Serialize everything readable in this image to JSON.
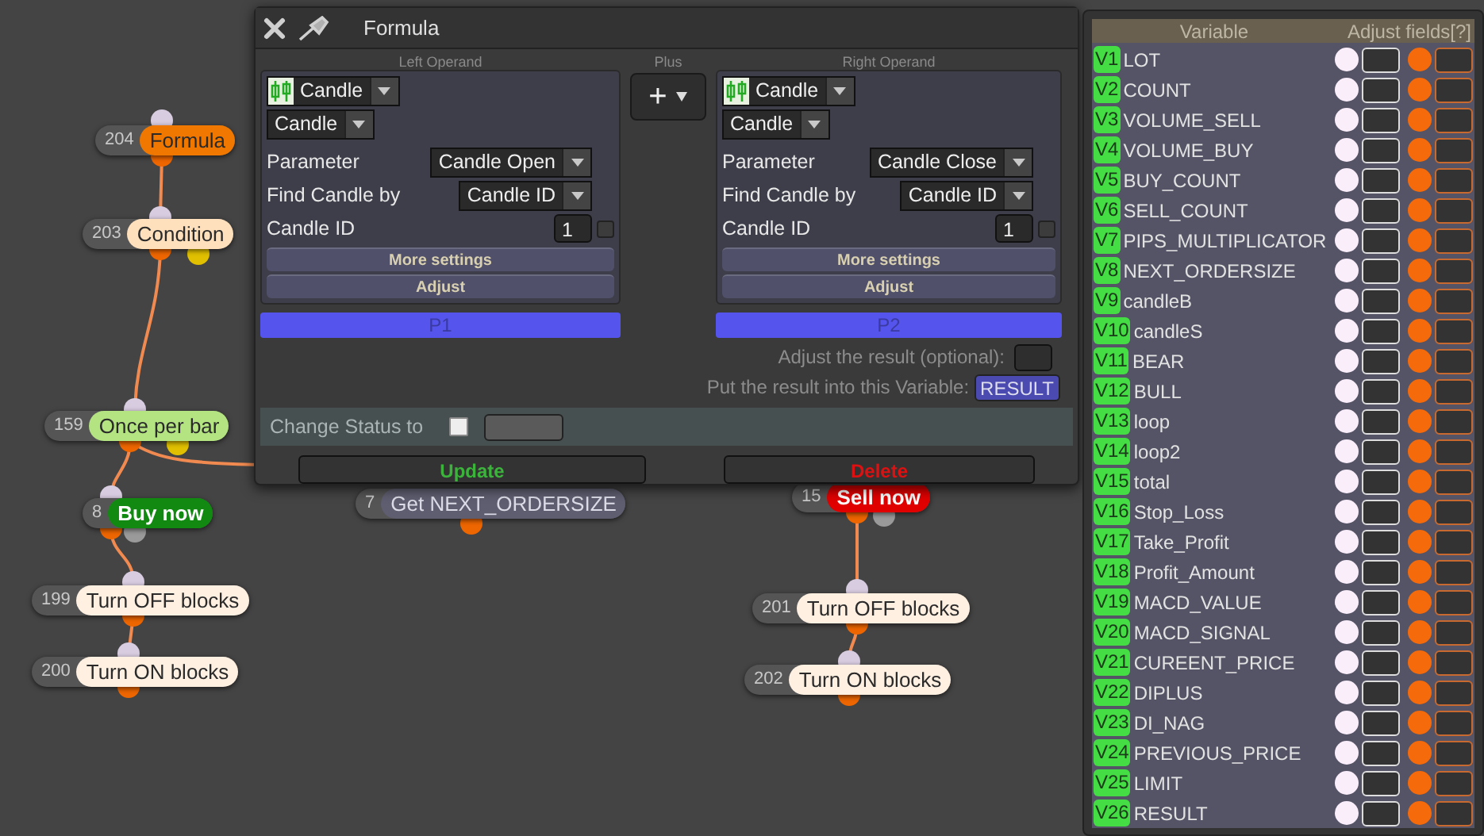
{
  "canvas": {
    "nodes": [
      {
        "number": "204",
        "label": "Formula",
        "color": "#f07800",
        "bold": false
      },
      {
        "number": "203",
        "label": "Condition",
        "color": "#ffe0bc",
        "bold": false
      },
      {
        "number": "159",
        "label": "Once per bar",
        "color": "#b4e482",
        "bold": false
      },
      {
        "number": "8",
        "label": "Buy now",
        "color": "#128a12",
        "bold": true
      },
      {
        "number": "7",
        "label": "Get NEXT_ORDERSIZE",
        "color": "#5e5e70",
        "bold": false
      },
      {
        "number": "15",
        "label": "Sell now",
        "color": "#e00000",
        "bold": true
      },
      {
        "number": "199",
        "label": "Turn OFF blocks",
        "color": "#fff0e2",
        "bold": false
      },
      {
        "number": "200",
        "label": "Turn ON blocks",
        "color": "#fff0e2",
        "bold": false
      },
      {
        "number": "201",
        "label": "Turn OFF blocks",
        "color": "#fff0e2",
        "bold": false
      },
      {
        "number": "202",
        "label": "Turn ON blocks",
        "color": "#fff0e2",
        "bold": false
      }
    ]
  },
  "formula_dialog": {
    "title": "Formula",
    "operands": [
      {
        "heading": "Left Operand",
        "source": "Candle",
        "type": "Candle",
        "parameter_label": "Parameter",
        "parameter": "Candle Open",
        "find_label": "Find Candle by",
        "find_by": "Candle ID",
        "id_label": "Candle ID",
        "id_value": "1",
        "id_checked": false,
        "more_settings": "More settings",
        "adjust": "Adjust",
        "bar": "P1"
      },
      {
        "heading": "Right Operand",
        "source": "Candle",
        "type": "Candle",
        "parameter_label": "Parameter",
        "parameter": "Candle Close",
        "find_label": "Find Candle by",
        "find_by": "Candle ID",
        "id_label": "Candle ID",
        "id_value": "1",
        "id_checked": false,
        "more_settings": "More settings",
        "adjust": "Adjust",
        "bar": "P2"
      }
    ],
    "operator": {
      "heading": "Plus",
      "symbol": "+"
    },
    "adjust_result_label": "Adjust the result (optional):",
    "result_variable_label": "Put the result into this Variable:",
    "result_variable": "RESULT",
    "change_status": {
      "label": "Change Status to",
      "checked": false
    },
    "update": "Update",
    "delete": "Delete"
  },
  "variables": {
    "columns": [
      "Variable",
      "Adjust fields[?]"
    ],
    "rows": [
      {
        "tag": "V1",
        "name": "LOT"
      },
      {
        "tag": "V2",
        "name": "COUNT"
      },
      {
        "tag": "V3",
        "name": "VOLUME_SELL"
      },
      {
        "tag": "V4",
        "name": "VOLUME_BUY"
      },
      {
        "tag": "V5",
        "name": "BUY_COUNT"
      },
      {
        "tag": "V6",
        "name": "SELL_COUNT"
      },
      {
        "tag": "V7",
        "name": "PIPS_MULTIPLICATOR"
      },
      {
        "tag": "V8",
        "name": "NEXT_ORDERSIZE"
      },
      {
        "tag": "V9",
        "name": "candleB"
      },
      {
        "tag": "V10",
        "name": "candleS"
      },
      {
        "tag": "V11",
        "name": "BEAR"
      },
      {
        "tag": "V12",
        "name": "BULL"
      },
      {
        "tag": "V13",
        "name": "loop"
      },
      {
        "tag": "V14",
        "name": "loop2"
      },
      {
        "tag": "V15",
        "name": "total"
      },
      {
        "tag": "V16",
        "name": "Stop_Loss"
      },
      {
        "tag": "V17",
        "name": "Take_Profit"
      },
      {
        "tag": "V18",
        "name": "Profit_Amount"
      },
      {
        "tag": "V19",
        "name": "MACD_VALUE"
      },
      {
        "tag": "V20",
        "name": "MACD_SIGNAL"
      },
      {
        "tag": "V21",
        "name": "CUREENT_PRICE"
      },
      {
        "tag": "V22",
        "name": "DIPLUS"
      },
      {
        "tag": "V23",
        "name": "DI_NAG"
      },
      {
        "tag": "V24",
        "name": "PREVIOUS_PRICE"
      },
      {
        "tag": "V25",
        "name": "LIMIT"
      },
      {
        "tag": "V26",
        "name": "RESULT"
      }
    ]
  }
}
